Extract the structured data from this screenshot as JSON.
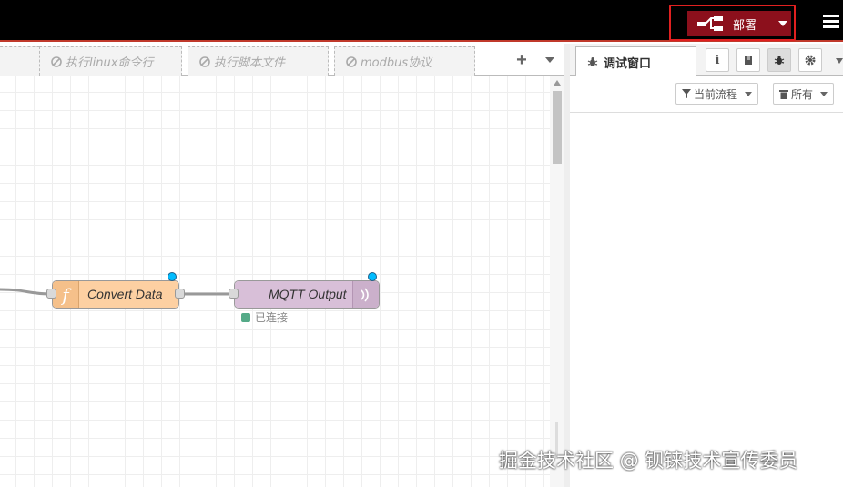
{
  "header": {
    "deploy_label": "部署",
    "deploy_icon": "deploy-icon",
    "menu_icon": "hamburger-menu-icon"
  },
  "workspace": {
    "tabs": [
      {
        "label": "执行linux命令行",
        "state": "disabled"
      },
      {
        "label": "执行脚本文件",
        "state": "disabled"
      },
      {
        "label": "modbus协议",
        "state": "disabled"
      }
    ],
    "add_tab_label": "+",
    "nodes": [
      {
        "label": "Convert Data",
        "type": "function",
        "color": "#fdd0a2"
      },
      {
        "label": "MQTT Output",
        "type": "mqtt out",
        "color": "#d8bfd8",
        "status": "已连接",
        "status_color": "#55aa88"
      }
    ]
  },
  "sidebar": {
    "active_tab": "调试窗口",
    "tab_icons": [
      "info-icon",
      "book-icon",
      "bug-icon",
      "gear-icon"
    ],
    "filter_label": "当前流程",
    "clear_label": "所有"
  },
  "watermark": "掘金技术社区 @ 钡铼技术宣传委员",
  "colors": {
    "header_bg": "#000000",
    "deploy_bg": "#8c101c",
    "highlight_border": "#e02020",
    "changed_badge": "#00bcff"
  }
}
